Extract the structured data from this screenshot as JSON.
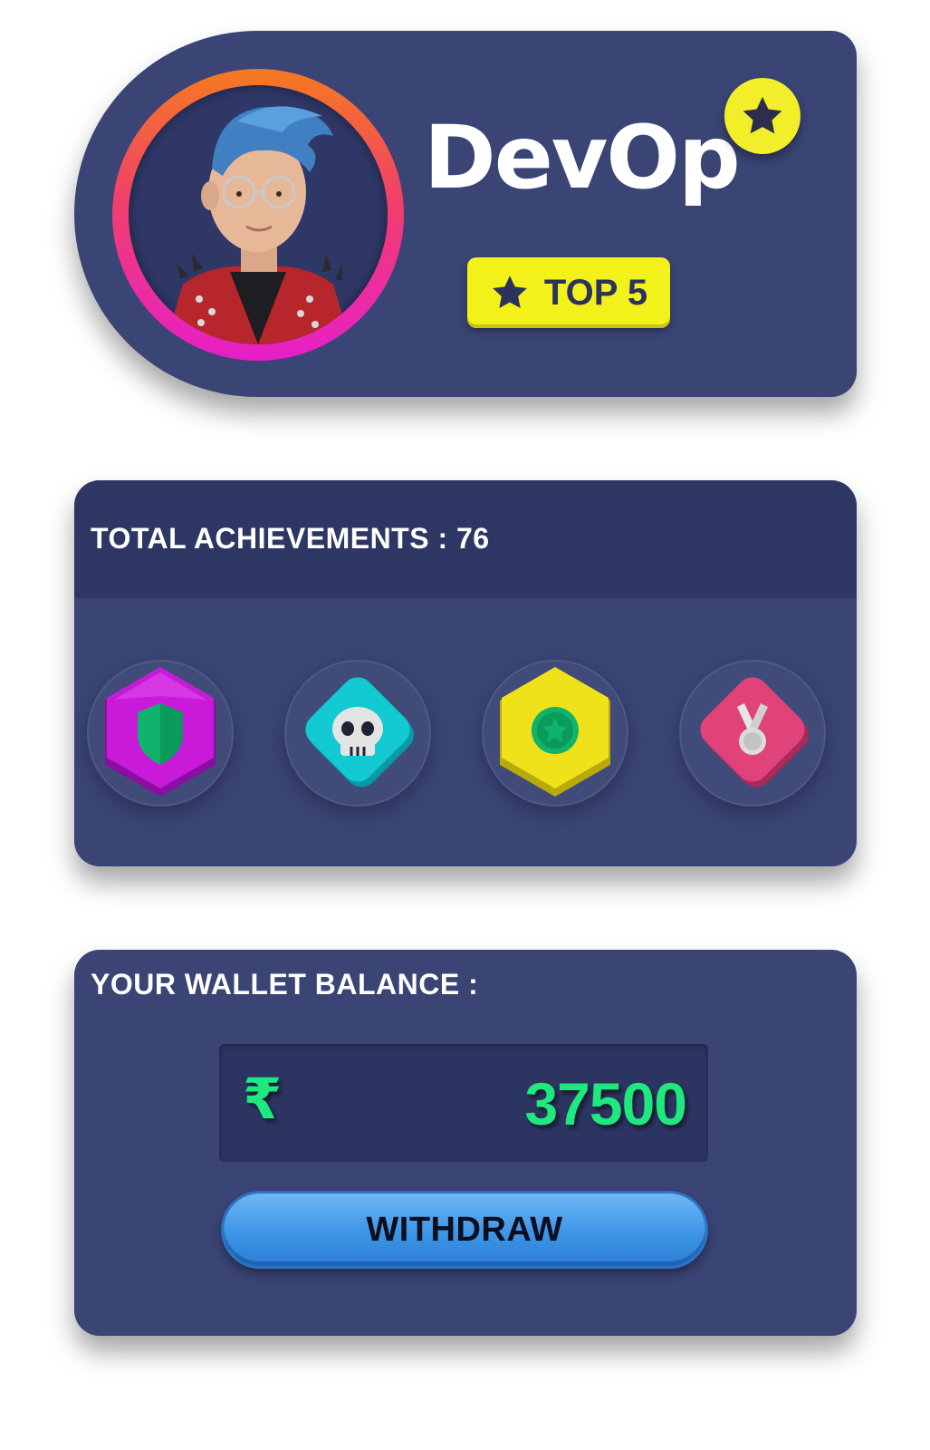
{
  "profile": {
    "username": "DevOp",
    "rank_label": "TOP 5",
    "avatar_ring_colors": [
      "#f47a1f",
      "#f23f6b",
      "#e61fc8"
    ],
    "star_badge_color": "#f2ef2a"
  },
  "achievements": {
    "title": "TOTAL ACHIEVEMENTS : 76",
    "badges": [
      {
        "icon": "shield-icon",
        "shape": "hexagon",
        "color": "#c81ad8"
      },
      {
        "icon": "skull-icon",
        "shape": "diamond",
        "color": "#13c9d2"
      },
      {
        "icon": "star-coin-icon",
        "shape": "hexagon",
        "color": "#f0e21a"
      },
      {
        "icon": "medal-icon",
        "shape": "diamond",
        "color": "#e0427a"
      }
    ]
  },
  "wallet": {
    "title": "YOUR WALLET BALANCE :",
    "currency_symbol": "₹",
    "balance": "37500",
    "withdraw_label": "WITHDRAW",
    "balance_color": "#1ee87e"
  },
  "colors": {
    "card_bg": "#3a4475",
    "header_bg": "#2e3763",
    "button_blue": "#3d95e6"
  }
}
